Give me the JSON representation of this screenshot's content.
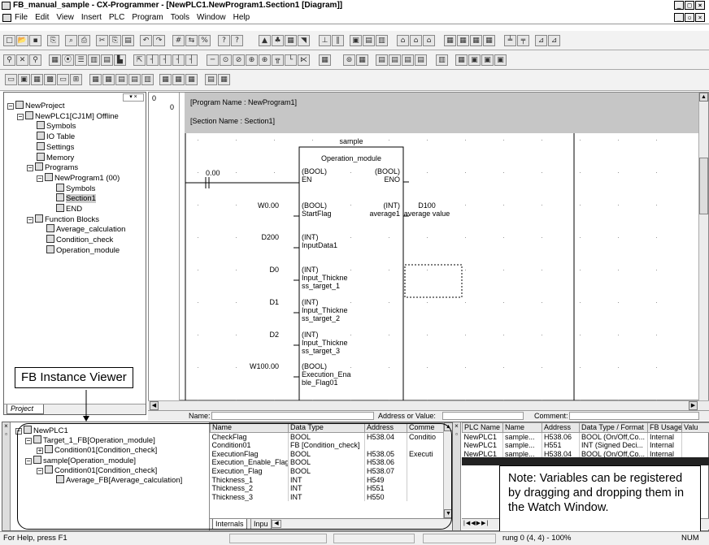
{
  "window": {
    "title": "FB_manual_sample - CX-Programmer - [NewPLC1.NewProgram1.Section1 [Diagram]]",
    "min": "_",
    "max": "□",
    "close": "×",
    "doc_min": "_",
    "doc_restore": "▫",
    "doc_close": "×"
  },
  "menu": [
    "File",
    "Edit",
    "View",
    "Insert",
    "PLC",
    "Program",
    "Tools",
    "Window",
    "Help"
  ],
  "project_tree": {
    "items": [
      {
        "label": "NewProject",
        "icon": "project-icon"
      },
      {
        "label": "NewPLC1[CJ1M] Offline",
        "icon": "plc-icon"
      },
      {
        "label": "Symbols",
        "icon": "symbols-icon"
      },
      {
        "label": "IO Table",
        "icon": "io-table-icon"
      },
      {
        "label": "Settings",
        "icon": "settings-icon"
      },
      {
        "label": "Memory",
        "icon": "memory-icon"
      },
      {
        "label": "Programs",
        "icon": "programs-icon"
      },
      {
        "label": "NewProgram1 (00)",
        "icon": "program-icon"
      },
      {
        "label": "Symbols",
        "icon": "symbols-icon"
      },
      {
        "label": "Section1",
        "icon": "section-icon"
      },
      {
        "label": "END",
        "icon": "section-icon"
      },
      {
        "label": "Function Blocks",
        "icon": "function-blocks-icon"
      },
      {
        "label": "Average_calculation",
        "icon": "fb-icon"
      },
      {
        "label": "Condition_check",
        "icon": "fb-icon"
      },
      {
        "label": "Operation_module",
        "icon": "fb-icon"
      }
    ],
    "tab": "Project"
  },
  "diagram": {
    "rung_number": "0",
    "rung_step": "0",
    "program_name": "[Program Name : NewProgram1]",
    "section_name": "[Section Name : Section1]",
    "instance_name": "sample",
    "fb_name": "Operation_module",
    "contact_addr": "0.00",
    "inputs": [
      {
        "operand": "",
        "type": "(BOOL)",
        "name": "EN"
      },
      {
        "operand": "W0.00",
        "type": "(BOOL)",
        "name": "StartFlag"
      },
      {
        "operand": "D200",
        "type": "(INT)",
        "name": "InputData1"
      },
      {
        "operand": "D0",
        "type": "(INT)",
        "name": "Input_Thickne\nss_target_1"
      },
      {
        "operand": "D1",
        "type": "(INT)",
        "name": "Input_Thickne\nss_target_2"
      },
      {
        "operand": "D2",
        "type": "(INT)",
        "name": "Input_Thickne\nss_target_3"
      },
      {
        "operand": "W100.00",
        "type": "(BOOL)",
        "name": "Execution_Ena\nble_Flag01"
      }
    ],
    "outputs": [
      {
        "type": "(BOOL)",
        "name": "ENO",
        "operand": "",
        "comment": ""
      },
      {
        "type": "(INT)",
        "name": "average1",
        "operand": "D100",
        "comment": "average value"
      }
    ]
  },
  "name_bar": {
    "name_label": "Name:",
    "address_label": "Address or Value:",
    "comment_label": "Comment:"
  },
  "fb_instance_viewer": {
    "callout": "FB Instance Viewer",
    "tree": [
      {
        "label": "NewPLC1",
        "icon": "plc-icon"
      },
      {
        "label": "Target_1_FB[Operation_module]",
        "icon": "fb-icon"
      },
      {
        "label": "Condition01[Condition_check]",
        "icon": "fb-icon"
      },
      {
        "label": "sample[Operation_module]",
        "icon": "fb-icon"
      },
      {
        "label": "Condition01[Condition_check]",
        "icon": "fb-icon"
      },
      {
        "label": "Average_FB[Average_calculation]",
        "icon": "fb-icon"
      }
    ],
    "table": {
      "headers": [
        "Name",
        "Data Type",
        "Address",
        "Comme"
      ],
      "rows": [
        [
          "CheckFlag",
          "BOOL",
          "H538.04",
          "Conditio"
        ],
        [
          "Condition01",
          "FB [Condition_check]",
          "",
          ""
        ],
        [
          "ExecutionFlag",
          "BOOL",
          "H538.05",
          "Executi"
        ],
        [
          "Execution_Enable_Flag",
          "BOOL",
          "H538.06",
          ""
        ],
        [
          "Execution_Flag",
          "BOOL",
          "H538.07",
          ""
        ],
        [
          "Thickness_1",
          "INT",
          "H549",
          ""
        ],
        [
          "Thickness_2",
          "INT",
          "H551",
          ""
        ],
        [
          "Thickness_3",
          "INT",
          "H550",
          ""
        ]
      ],
      "tabs": [
        "Internals",
        "Inpu"
      ]
    }
  },
  "watch_window": {
    "headers": [
      "PLC Name",
      "Name",
      "Address",
      "Data Type / Format",
      "FB Usage",
      "Valu"
    ],
    "rows": [
      [
        "NewPLC1",
        "sample...",
        "H538.06",
        "BOOL (On/Off,Co...",
        "Internal",
        ""
      ],
      [
        "NewPLC1",
        "sample...",
        "H551",
        "INT (Signed Deci...",
        "Internal",
        ""
      ],
      [
        "NewPLC1",
        "sample...",
        "H538.04",
        "BOOL (On/Off,Co...",
        "Internal",
        ""
      ]
    ],
    "note": "Note: Variables can be registered by dragging and dropping them in the Watch Window."
  },
  "status": {
    "help": "For Help, press F1",
    "rung": "rung 0 (4, 4) - 100%",
    "mode": "NUM"
  }
}
